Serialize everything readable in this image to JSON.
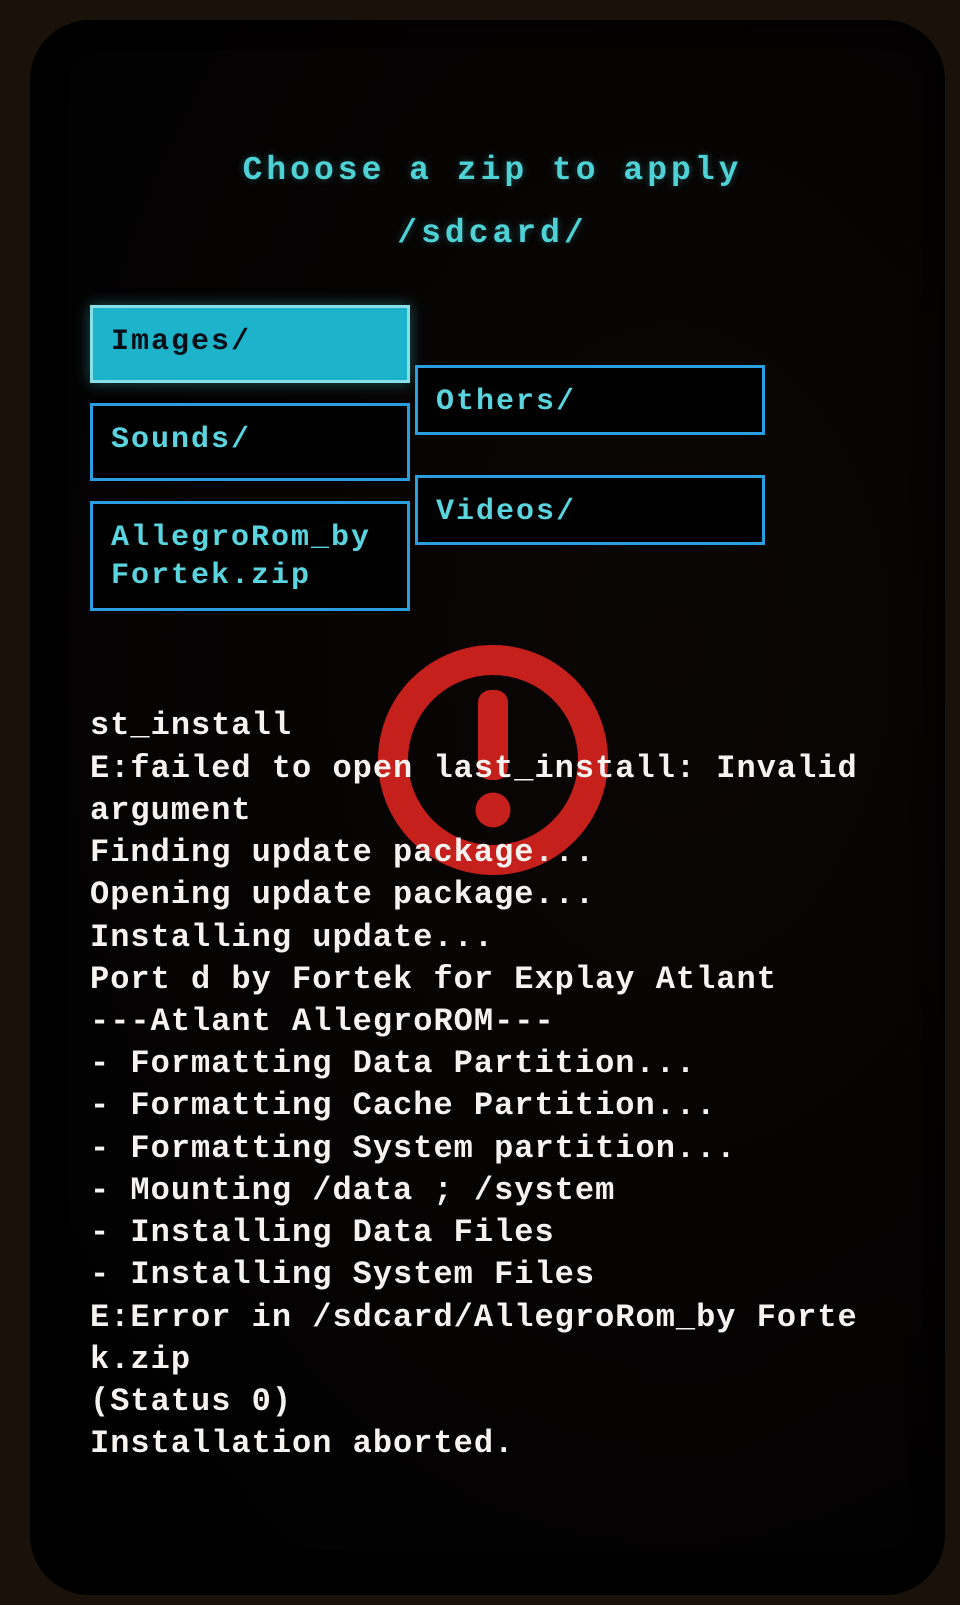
{
  "header": {
    "title": "Choose a zip to apply",
    "path": "/sdcard/"
  },
  "files": {
    "images": "Images/",
    "others": "Others/",
    "sounds": "Sounds/",
    "videos": "Videos/",
    "allegro": "AllegroRom_by Fortek.zip"
  },
  "selected": "images",
  "error_icon": "warning-exclamation",
  "log": "st_install\nE:failed to open last_install: Invalid argument\nFinding update package...\nOpening update package...\nInstalling update...\nPort d by Fortek for Explay Atlant\n---Atlant AllegroROM---\n- Formatting Data Partition...\n- Formatting Cache Partition...\n- Formatting System partition...\n- Mounting /data ; /system\n- Installing Data Files\n- Installing System Files\nE:Error in /sdcard/AllegroRom_by Fortek.zip\n(Status 0)\nInstallation aborted."
}
